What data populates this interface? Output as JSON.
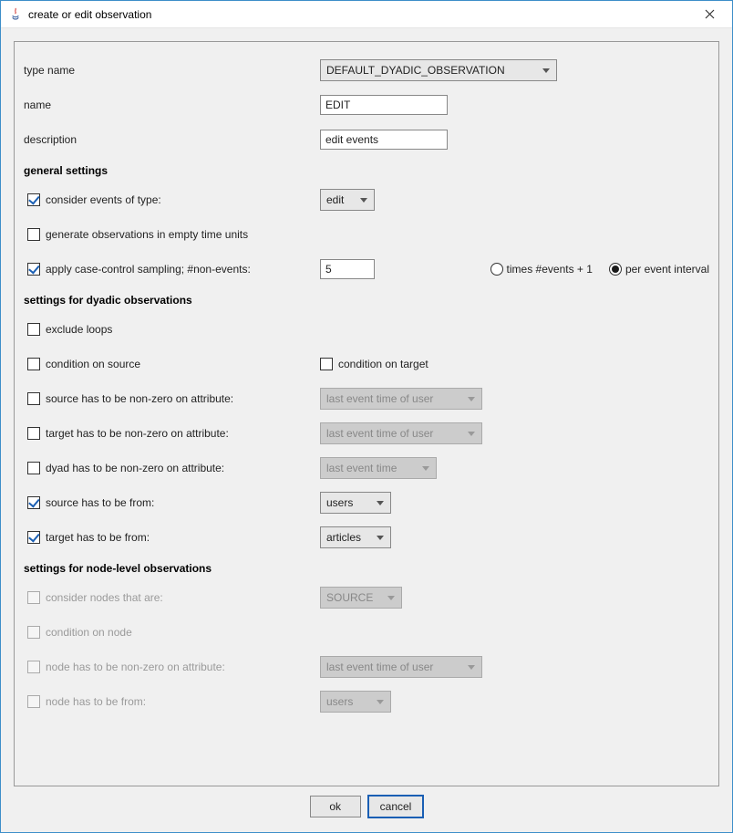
{
  "window": {
    "title": "create or edit observation"
  },
  "form": {
    "type_name_label": "type name",
    "type_name_value": "DEFAULT_DYADIC_OBSERVATION",
    "name_label": "name",
    "name_value": "EDIT",
    "description_label": "description",
    "description_value": "edit events"
  },
  "sections": {
    "general": "general settings",
    "dyadic": "settings for dyadic observations",
    "node": "settings for node-level observations"
  },
  "general": {
    "consider_events_label": "consider events of type:",
    "consider_events_value": "edit",
    "generate_empty_label": "generate observations in empty time units",
    "case_control_label": "apply case-control sampling; #non-events:",
    "case_control_value": "5",
    "radio_times_label": "times #events + 1",
    "radio_per_interval_label": "per event interval"
  },
  "dyadic": {
    "exclude_loops_label": "exclude loops",
    "condition_source_label": "condition on source",
    "condition_target_label": "condition on target",
    "source_nonzero_label": "source has to be non-zero on attribute:",
    "source_nonzero_value": "last event time of user",
    "target_nonzero_label": "target has to be non-zero on attribute:",
    "target_nonzero_value": "last event time of user",
    "dyad_nonzero_label": "dyad has to be non-zero on attribute:",
    "dyad_nonzero_value": "last event time",
    "source_from_label": "source has to be from:",
    "source_from_value": "users",
    "target_from_label": "target has to be from:",
    "target_from_value": "articles"
  },
  "node": {
    "consider_nodes_label": "consider nodes that are:",
    "consider_nodes_value": "SOURCE",
    "condition_node_label": "condition on node",
    "node_nonzero_label": "node has to be non-zero on attribute:",
    "node_nonzero_value": "last event time of user",
    "node_from_label": "node has to be from:",
    "node_from_value": "users"
  },
  "buttons": {
    "ok": "ok",
    "cancel": "cancel"
  }
}
